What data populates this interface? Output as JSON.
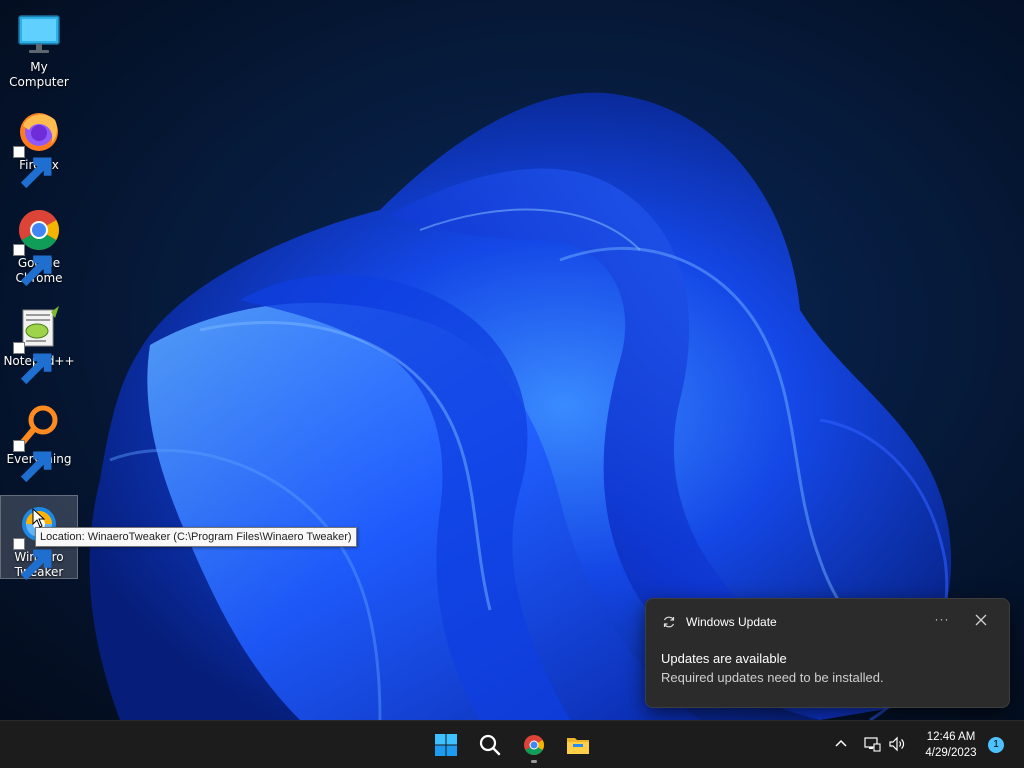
{
  "desktop": {
    "icons": [
      {
        "label": "My Computer",
        "icon": "monitor-icon"
      },
      {
        "label": "Firefox",
        "icon": "firefox-icon"
      },
      {
        "label": "Google Chrome",
        "icon": "chrome-icon"
      },
      {
        "label": "Notepad++",
        "icon": "notepadpp-icon"
      },
      {
        "label": "Everything",
        "icon": "everything-search-icon"
      },
      {
        "label": "Winaero Tweaker",
        "icon": "winaero-tweaker-icon"
      }
    ],
    "tooltip": "Location: WinaeroTweaker (C:\\Program Files\\Winaero Tweaker)"
  },
  "toast": {
    "app_name": "Windows Update",
    "more_label": "···",
    "title": "Updates are available",
    "body": "Required updates need to be installed."
  },
  "taskbar": {
    "pinned": [
      {
        "name": "start",
        "icon": "windows-start-icon"
      },
      {
        "name": "search",
        "icon": "search-icon"
      },
      {
        "name": "chrome",
        "icon": "chrome-icon"
      },
      {
        "name": "file-explorer",
        "icon": "folder-icon"
      }
    ],
    "tray": {
      "time": "12:46 AM",
      "date": "4/29/2023",
      "notification_count": "1"
    }
  },
  "colors": {
    "accent": "#4cc2ff",
    "taskbar_bg": "#1c1c1c",
    "toast_bg": "#2b2b2b",
    "wallpaper_blue": "#1a5cff"
  }
}
